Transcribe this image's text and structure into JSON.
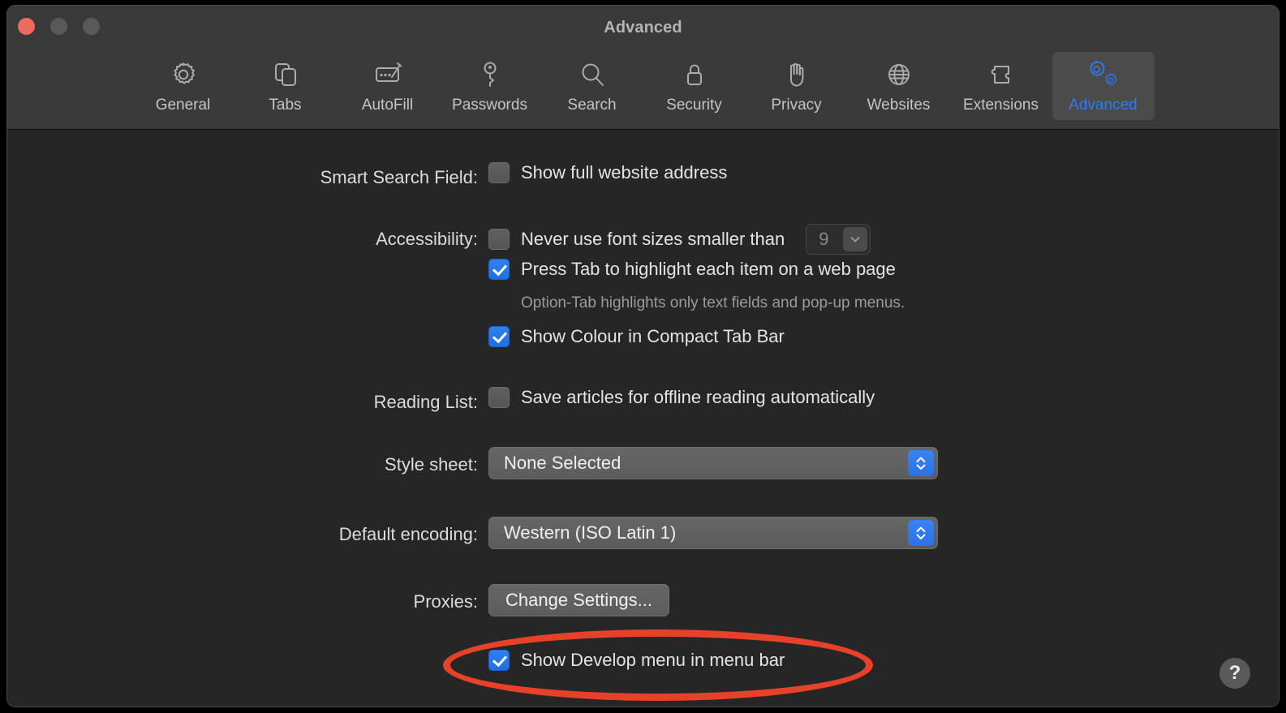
{
  "window": {
    "title": "Advanced",
    "traffic_lights": [
      {
        "name": "close",
        "color": "#ec6a5e"
      },
      {
        "name": "minimize",
        "color": "#595959"
      },
      {
        "name": "zoom",
        "color": "#595959"
      }
    ]
  },
  "toolbar": {
    "items": [
      {
        "label": "General",
        "icon": "gear-icon",
        "selected": false
      },
      {
        "label": "Tabs",
        "icon": "tabs-icon",
        "selected": false
      },
      {
        "label": "AutoFill",
        "icon": "autofill-icon",
        "selected": false
      },
      {
        "label": "Passwords",
        "icon": "key-icon",
        "selected": false
      },
      {
        "label": "Search",
        "icon": "magnifier-icon",
        "selected": false
      },
      {
        "label": "Security",
        "icon": "lock-icon",
        "selected": false
      },
      {
        "label": "Privacy",
        "icon": "hand-icon",
        "selected": false
      },
      {
        "label": "Websites",
        "icon": "globe-icon",
        "selected": false
      },
      {
        "label": "Extensions",
        "icon": "puzzle-icon",
        "selected": false
      },
      {
        "label": "Advanced",
        "icon": "double-gear-icon",
        "selected": true
      }
    ],
    "selected_color": "#2b7cf6"
  },
  "settings": {
    "smart_search_field": {
      "label": "Smart Search Field:",
      "checkbox_label": "Show full website address",
      "checked": false
    },
    "accessibility": {
      "label": "Accessibility:",
      "font_size_checkbox_label": "Never use font sizes smaller than",
      "font_size_checked": false,
      "font_size_value": "9",
      "tab_highlight_label": "Press Tab to highlight each item on a web page",
      "tab_highlight_checked": true,
      "tab_highlight_hint": "Option-Tab highlights only text fields and pop-up menus.",
      "compact_tab_colour_label": "Show Colour in Compact Tab Bar",
      "compact_tab_colour_checked": true
    },
    "reading_list": {
      "label": "Reading List:",
      "checkbox_label": "Save articles for offline reading automatically",
      "checked": false
    },
    "style_sheet": {
      "label": "Style sheet:",
      "value": "None Selected"
    },
    "default_encoding": {
      "label": "Default encoding:",
      "value": "Western (ISO Latin 1)"
    },
    "proxies": {
      "label": "Proxies:",
      "button_label": "Change Settings..."
    },
    "develop_menu": {
      "checkbox_label": "Show Develop menu in menu bar",
      "checked": true
    }
  },
  "annotation": {
    "shape": "ellipse",
    "color": "#e8412a",
    "target": "Show Develop menu in menu bar"
  },
  "help": {
    "glyph": "?"
  }
}
